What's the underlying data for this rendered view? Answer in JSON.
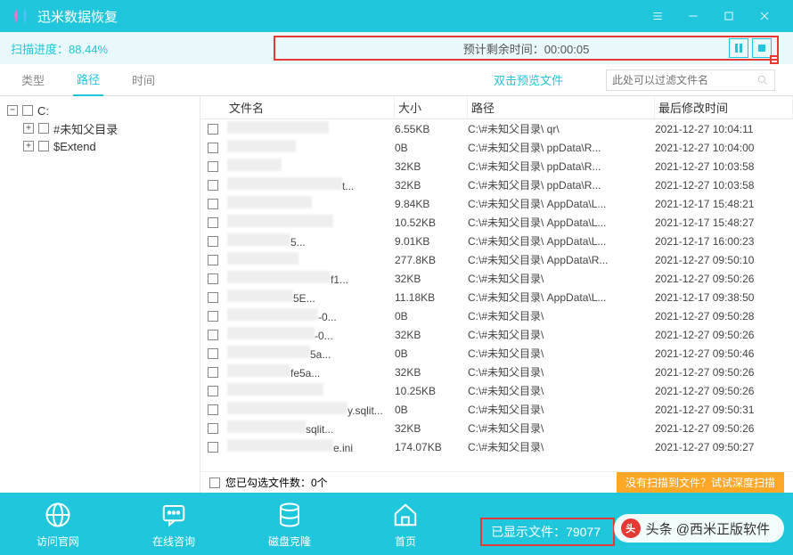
{
  "title": "迅米数据恢复",
  "progress": {
    "label": "扫描进度：",
    "percent": "88.44%",
    "time_label": "预计剩余时间：",
    "time_value": "00:00:05"
  },
  "tabs": {
    "type": "类型",
    "path": "路径",
    "time": "时间"
  },
  "preview_hint": "双击预览文件",
  "search_placeholder": "此处可以过滤文件名",
  "tree": {
    "root": "C:",
    "child1": "#未知父目录",
    "child2": "$Extend"
  },
  "columns": {
    "name": "文件名",
    "size": "大小",
    "path": "路径",
    "date": "最后修改时间"
  },
  "rows": [
    {
      "name": "",
      "size": "6.55KB",
      "path": "C:\\#未知父目录\\            qr\\",
      "date": "2021-12-27 10:04:11"
    },
    {
      "name": "",
      "size": "0B",
      "path": "C:\\#未知父目录\\         ppData\\R...",
      "date": "2021-12-27 10:04:00"
    },
    {
      "name": "",
      "size": "32KB",
      "path": "C:\\#未知父目录\\         ppData\\R...",
      "date": "2021-12-27 10:03:58"
    },
    {
      "name": "t...",
      "size": "32KB",
      "path": "C:\\#未知父目录\\         ppData\\R...",
      "date": "2021-12-27 10:03:58"
    },
    {
      "name": "",
      "size": "9.84KB",
      "path": "C:\\#未知父目录\\         AppData\\L...",
      "date": "2021-12-17 15:48:21"
    },
    {
      "name": "",
      "size": "10.52KB",
      "path": "C:\\#未知父目录\\         AppData\\L...",
      "date": "2021-12-17 15:48:27"
    },
    {
      "name": "5...",
      "size": "9.01KB",
      "path": "C:\\#未知父目录\\         AppData\\L...",
      "date": "2021-12-17 16:00:23"
    },
    {
      "name": "",
      "size": "277.8KB",
      "path": "C:\\#未知父目录\\         AppData\\R...",
      "date": "2021-12-27 09:50:10"
    },
    {
      "name": "f1...",
      "size": "32KB",
      "path": "C:\\#未知父目录\\",
      "date": "2021-12-27 09:50:26"
    },
    {
      "name": "5E...",
      "size": "11.18KB",
      "path": "C:\\#未知父目录\\         AppData\\L...",
      "date": "2021-12-17 09:38:50"
    },
    {
      "name": "-0...",
      "size": "0B",
      "path": "C:\\#未知父目录\\",
      "date": "2021-12-27 09:50:28"
    },
    {
      "name": "-0...",
      "size": "32KB",
      "path": "C:\\#未知父目录\\",
      "date": "2021-12-27 09:50:26"
    },
    {
      "name": "5a...",
      "size": "0B",
      "path": "C:\\#未知父目录\\",
      "date": "2021-12-27 09:50:46"
    },
    {
      "name": "fe5a...",
      "size": "32KB",
      "path": "C:\\#未知父目录\\",
      "date": "2021-12-27 09:50:26"
    },
    {
      "name": "",
      "size": "10.25KB",
      "path": "C:\\#未知父目录\\",
      "date": "2021-12-27 09:50:26"
    },
    {
      "name": "y.sqlit...",
      "size": "0B",
      "path": "C:\\#未知父目录\\",
      "date": "2021-12-27 09:50:31"
    },
    {
      "name": "sqlit...",
      "size": "32KB",
      "path": "C:\\#未知父目录\\",
      "date": "2021-12-27 09:50:26"
    },
    {
      "name": "e.ini",
      "size": "174.07KB",
      "path": "C:\\#未知父目录\\",
      "date": "2021-12-27 09:50:27"
    }
  ],
  "selected_count_label": "您已勾选文件数：0个",
  "deep_scan_label": "没有扫描到文件？试试深度扫描",
  "bottom": {
    "website": "访问官网",
    "chat": "在线咨询",
    "clone": "磁盘克隆",
    "home": "首页"
  },
  "file_count": {
    "label": "已显示文件：",
    "value": "79077"
  },
  "watermark": {
    "prefix": "头条",
    "text": "@西米正版软件"
  }
}
